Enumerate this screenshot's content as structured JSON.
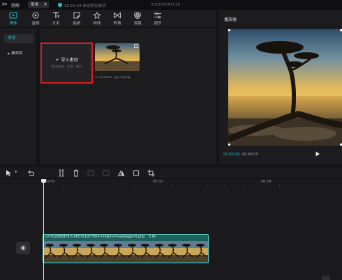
{
  "titlebar": {
    "app_name": "剪映",
    "menu_label": "菜单",
    "save_status": "15:21:59 自动保存成功",
    "project_name": "202105041519"
  },
  "tool_tabs": [
    {
      "label": "媒体",
      "icon": "media-icon",
      "active": true
    },
    {
      "label": "音频",
      "icon": "audio-icon",
      "active": false
    },
    {
      "label": "文本",
      "icon": "text-icon",
      "active": false
    },
    {
      "label": "贴纸",
      "icon": "sticker-icon",
      "active": false
    },
    {
      "label": "特效",
      "icon": "effects-icon",
      "active": false
    },
    {
      "label": "转场",
      "icon": "transition-icon",
      "active": false
    },
    {
      "label": "滤镜",
      "icon": "filter-icon",
      "active": false
    },
    {
      "label": "调节",
      "icon": "adjust-icon",
      "active": false
    }
  ],
  "sidebar": {
    "items": [
      {
        "label": "本地"
      },
      {
        "label": "素材库"
      }
    ]
  },
  "import": {
    "title": "导入素材",
    "subtitle": "支持视频、音频、图片"
  },
  "media_item": {
    "caption": "u=302695...gp=0.png"
  },
  "player": {
    "title": "播放器",
    "time_current": "00:00:00",
    "time_total": "00:00:03"
  },
  "timeline": {
    "ruler_labels": [
      "00:00",
      "00:02",
      "00:04"
    ],
    "clip_name": "u=302695979 6,4857619776fm=26&fmt=auto&gp=0.png",
    "clip_duration": "3.0s"
  },
  "colors": {
    "accent": "#22c3c9",
    "highlight_border": "#d61f24",
    "clip_fill": "#1f5f5c",
    "clip_border": "#5ed0c8"
  }
}
